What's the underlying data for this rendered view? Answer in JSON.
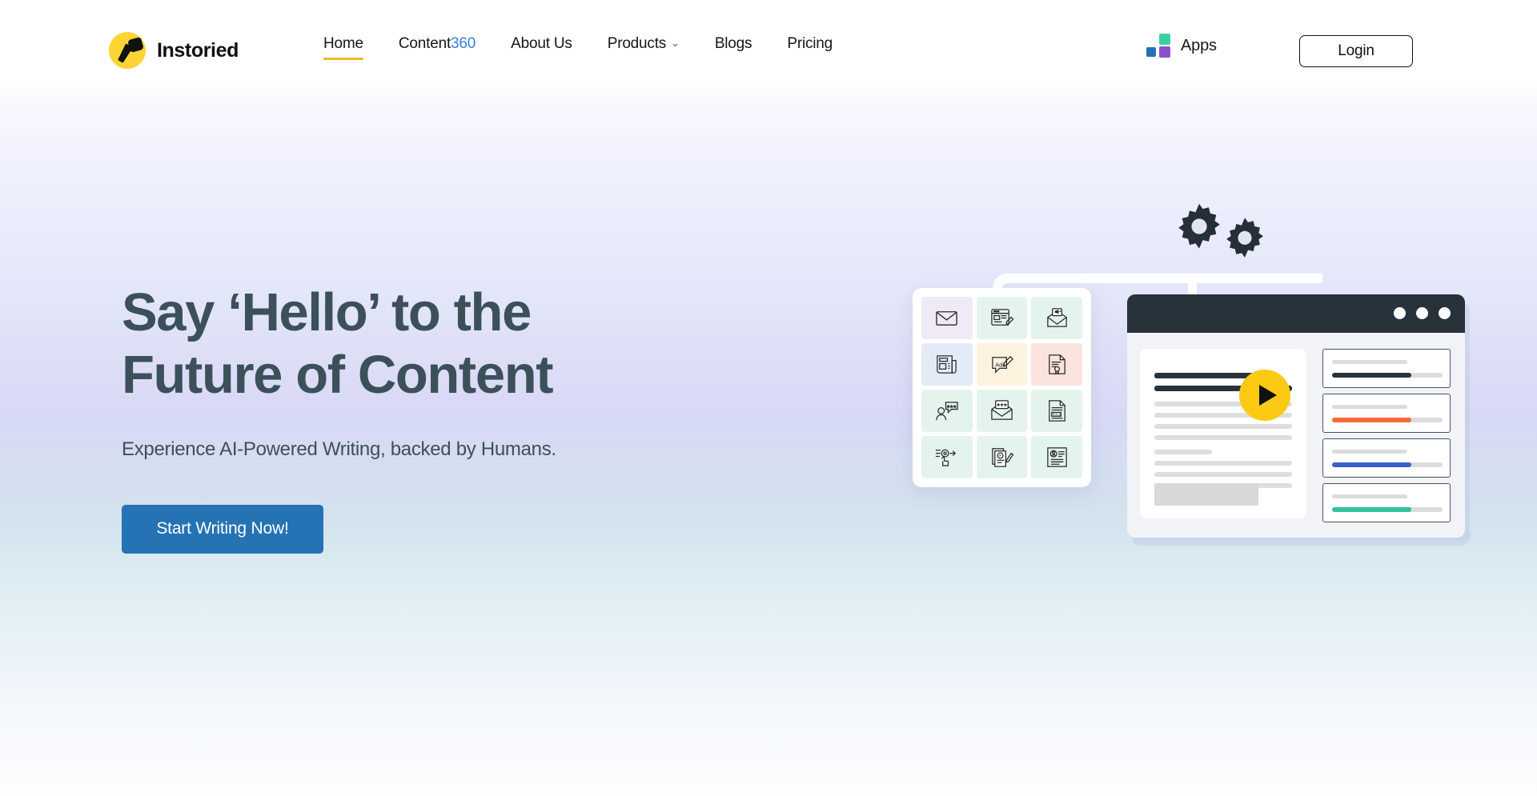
{
  "brand": {
    "name": "Instoried",
    "logo_icon": "quill-pen-logo-icon",
    "logo_bg": "#fcd535"
  },
  "nav": {
    "items": [
      {
        "label": "Home",
        "name": "nav-item-home",
        "active": true
      },
      {
        "label": "Content",
        "suffix": "360",
        "name": "nav-item-content360",
        "active": false
      },
      {
        "label": "About Us",
        "name": "nav-item-about-us",
        "active": false
      },
      {
        "label": "Products",
        "name": "nav-item-products",
        "active": false,
        "has_dropdown": true
      },
      {
        "label": "Blogs",
        "name": "nav-item-blogs",
        "active": false
      },
      {
        "label": "Pricing",
        "name": "nav-item-pricing",
        "active": false
      }
    ],
    "active_underline_color": "#f2bb24",
    "accent_color": "#3a7ce0"
  },
  "header_right": {
    "apps_label": "Apps",
    "apps_icon": "apps-grid-icon",
    "apps_colors": {
      "green": "#3ecfa0",
      "blue": "#2571b8",
      "purple": "#8a54c9"
    },
    "login_label": "Login"
  },
  "hero": {
    "title_line1": "Say ‘Hello’ to the",
    "title_line2": "Future of Content",
    "subtitle": "Experience AI-Powered Writing, backed by Humans.",
    "cta_label": "Start Writing Now!",
    "cta_color": "#2573b5",
    "title_color": "#3c5059"
  },
  "illustration": {
    "name": "content-platform-illustration",
    "gears": [
      "gear-icon",
      "gear-icon"
    ],
    "browser": {
      "window_dots": 3,
      "play_button": "play-icon",
      "play_color": "#fcc914"
    },
    "progress_cards": [
      {
        "name": "progress-card-dark",
        "color": "#28323b",
        "percent": 72
      },
      {
        "name": "progress-card-orange",
        "color": "#f46c37",
        "percent": 72
      },
      {
        "name": "progress-card-blue",
        "color": "#3a5fd0",
        "percent": 72
      },
      {
        "name": "progress-card-teal",
        "color": "#2ec39a",
        "percent": 72
      }
    ],
    "icon_tiles": [
      {
        "name": "email-icon",
        "bg": "#efeaf5"
      },
      {
        "name": "blog-editor-icon",
        "bg": "#e4f4ec"
      },
      {
        "name": "email-marketing-icon",
        "bg": "#e4f4ec"
      },
      {
        "name": "press-release-icon",
        "bg": "#e3ebf7"
      },
      {
        "name": "ads-copy-icon",
        "bg": "#fdf2dd"
      },
      {
        "name": "product-description-icon",
        "bg": "#fbe3de"
      },
      {
        "name": "testimonial-icon",
        "bg": "#e4f4ec"
      },
      {
        "name": "newsletter-icon",
        "bg": "#e4f4ec"
      },
      {
        "name": "pas-framework-icon",
        "bg": "#e4f4ec"
      },
      {
        "name": "workflow-icon",
        "bg": "#e4f4ec"
      },
      {
        "name": "video-script-icon",
        "bg": "#e4f4ec"
      },
      {
        "name": "profile-bio-icon",
        "bg": "#e4f4ec"
      }
    ]
  }
}
